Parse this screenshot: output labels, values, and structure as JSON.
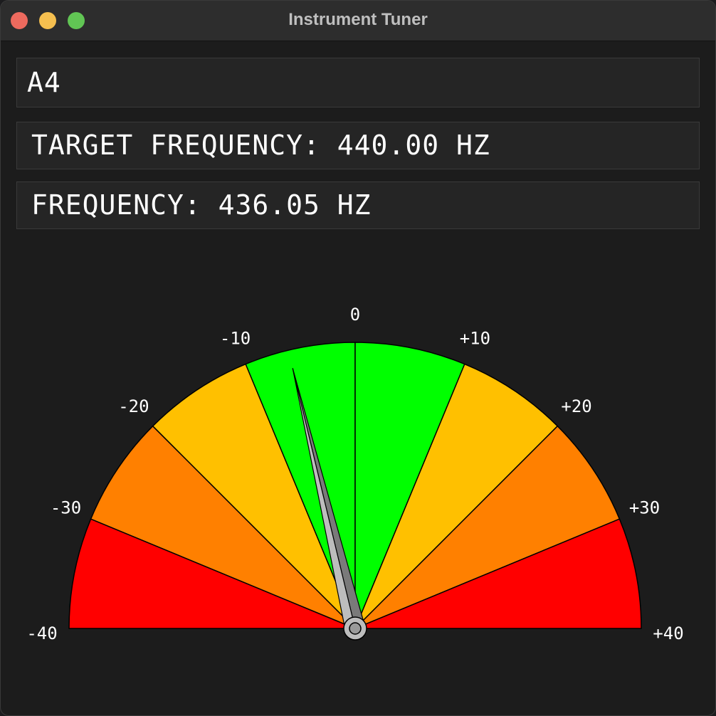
{
  "window": {
    "title": "Instrument Tuner"
  },
  "note": "A4",
  "target_frequency_label": "TARGET FREQUENCY: 440.00 HZ",
  "frequency_label": "FREQUENCY: 436.05 HZ",
  "gauge": {
    "min_cents": -40,
    "max_cents": 40,
    "needle_cents": -6.0,
    "ticks": [
      "-40",
      "-30",
      "-20",
      "-10",
      "0",
      "+10",
      "+20",
      "+30",
      "+40"
    ],
    "zones": [
      {
        "from": -40,
        "to": -30,
        "color": "#ff0000"
      },
      {
        "from": -30,
        "to": -20,
        "color": "#ff8000"
      },
      {
        "from": -20,
        "to": -10,
        "color": "#ffc000"
      },
      {
        "from": -10,
        "to": 0,
        "color": "#00ff00"
      },
      {
        "from": 0,
        "to": 10,
        "color": "#00ff00"
      },
      {
        "from": 10,
        "to": 20,
        "color": "#ffc000"
      },
      {
        "from": 20,
        "to": 30,
        "color": "#ff8000"
      },
      {
        "from": 30,
        "to": 40,
        "color": "#ff0000"
      }
    ]
  }
}
